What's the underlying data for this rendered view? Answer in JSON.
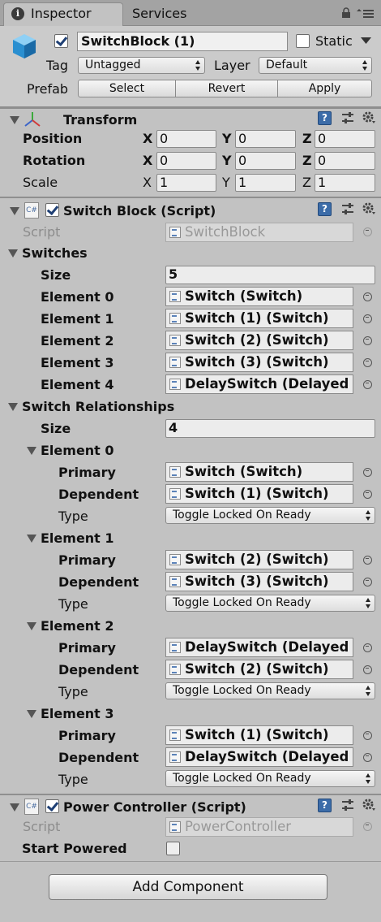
{
  "tabs": [
    {
      "label": "Inspector"
    },
    {
      "label": "Services"
    }
  ],
  "header": {
    "object_name": "SwitchBlock (1)",
    "static_label": "Static",
    "tag_label": "Tag",
    "tag_value": "Untagged",
    "layer_label": "Layer",
    "layer_value": "Default",
    "prefab_label": "Prefab",
    "prefab_buttons": {
      "select": "Select",
      "revert": "Revert",
      "apply": "Apply"
    }
  },
  "transform": {
    "title": "Transform",
    "axes": {
      "x": "X",
      "y": "Y",
      "z": "Z"
    },
    "position": {
      "label": "Position",
      "x": "0",
      "y": "0",
      "z": "0"
    },
    "rotation": {
      "label": "Rotation",
      "x": "0",
      "y": "0",
      "z": "0"
    },
    "scale": {
      "label": "Scale",
      "x": "1",
      "y": "1",
      "z": "1"
    }
  },
  "switch_block": {
    "title": "Switch Block (Script)",
    "script_label": "Script",
    "script_value": "SwitchBlock",
    "switches_label": "Switches",
    "size_label": "Size",
    "switches_size": "5",
    "switches": [
      {
        "label": "Element 0",
        "value": "Switch (Switch)"
      },
      {
        "label": "Element 1",
        "value": "Switch (1) (Switch)"
      },
      {
        "label": "Element 2",
        "value": "Switch (2) (Switch)"
      },
      {
        "label": "Element 3",
        "value": "Switch (3) (Switch)"
      },
      {
        "label": "Element 4",
        "value": "DelaySwitch (Delayed"
      }
    ],
    "relationships_label": "Switch Relationships",
    "relationships_size": "4",
    "primary_label": "Primary",
    "dependent_label": "Dependent",
    "type_label": "Type",
    "relationships": [
      {
        "label": "Element 0",
        "primary": "Switch (Switch)",
        "dependent": "Switch (1) (Switch)",
        "type": "Toggle Locked On Ready"
      },
      {
        "label": "Element 1",
        "primary": "Switch (2) (Switch)",
        "dependent": "Switch (3) (Switch)",
        "type": "Toggle Locked On Ready"
      },
      {
        "label": "Element 2",
        "primary": "DelaySwitch (Delayed",
        "dependent": "Switch (2) (Switch)",
        "type": "Toggle Locked On Ready"
      },
      {
        "label": "Element 3",
        "primary": "Switch (1) (Switch)",
        "dependent": "DelaySwitch (Delayed",
        "type": "Toggle Locked On Ready"
      }
    ]
  },
  "power_controller": {
    "title": "Power Controller (Script)",
    "script_label": "Script",
    "script_value": "PowerController",
    "start_powered_label": "Start Powered"
  },
  "add_component_label": "Add Component",
  "icon_help": "?",
  "icon_cs": "C#",
  "icon_info": "i"
}
